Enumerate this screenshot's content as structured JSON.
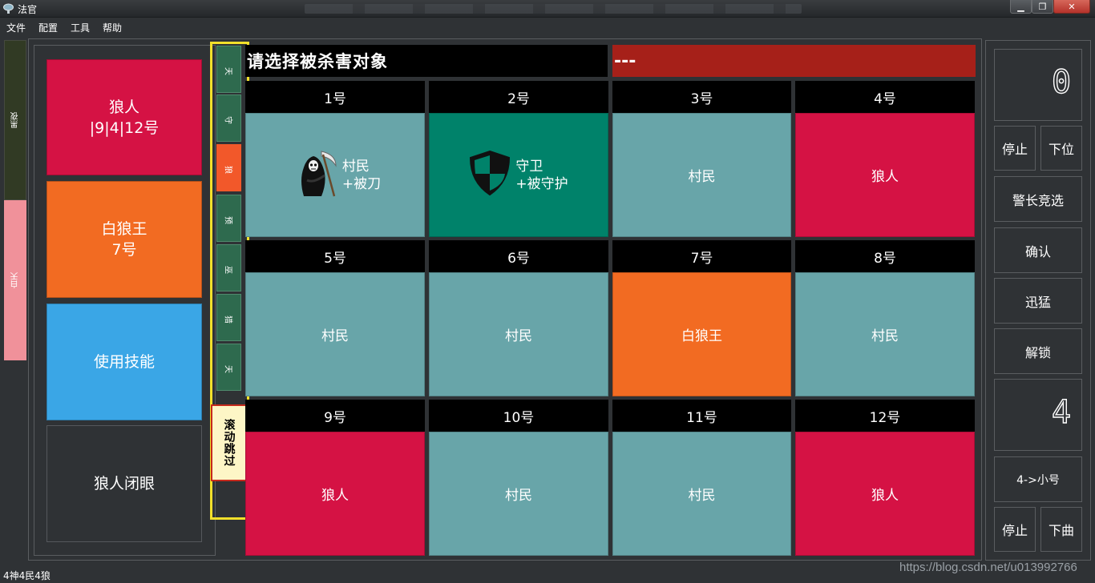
{
  "window": {
    "title": "法官"
  },
  "menu": [
    "文件",
    "配置",
    "工具",
    "帮助"
  ],
  "phase_tabs": {
    "night": "黑夜",
    "day": "白天"
  },
  "left_buttons": {
    "wolf": {
      "name": "狼人",
      "players": "|9|4|12号"
    },
    "white_wolf": {
      "name": "白狼王",
      "players": "7号"
    },
    "use_skill": "使用技能",
    "close_eyes": "狼人闭眼"
  },
  "role_tabs": [
    {
      "label": "天",
      "active": false
    },
    {
      "label": "守",
      "active": false
    },
    {
      "label": "狼",
      "active": true
    },
    {
      "label": "预",
      "active": false
    },
    {
      "label": "巫",
      "active": false
    },
    {
      "label": "猎",
      "active": false
    },
    {
      "label": "天",
      "active": false
    }
  ],
  "scroll_skip": "滚动跳过",
  "header": {
    "prompt": "请选择被杀害对象",
    "status": "---"
  },
  "players": [
    {
      "num": "1号",
      "role": "村民",
      "note": "+被刀",
      "icon": "reaper-icon",
      "color": "villager"
    },
    {
      "num": "2号",
      "role": "守卫",
      "note": "+被守护",
      "icon": "shield-icon",
      "color": "guard"
    },
    {
      "num": "3号",
      "role": "村民",
      "note": "",
      "icon": "",
      "color": "villager"
    },
    {
      "num": "4号",
      "role": "狼人",
      "note": "",
      "icon": "",
      "color": "wolf"
    },
    {
      "num": "5号",
      "role": "村民",
      "note": "",
      "icon": "",
      "color": "villager"
    },
    {
      "num": "6号",
      "role": "村民",
      "note": "",
      "icon": "",
      "color": "villager"
    },
    {
      "num": "7号",
      "role": "白狼王",
      "note": "",
      "icon": "",
      "color": "white"
    },
    {
      "num": "8号",
      "role": "村民",
      "note": "",
      "icon": "",
      "color": "villager"
    },
    {
      "num": "9号",
      "role": "狼人",
      "note": "",
      "icon": "",
      "color": "wolf"
    },
    {
      "num": "10号",
      "role": "村民",
      "note": "",
      "icon": "",
      "color": "villager"
    },
    {
      "num": "11号",
      "role": "村民",
      "note": "",
      "icon": "",
      "color": "villager"
    },
    {
      "num": "12号",
      "role": "狼人",
      "note": "",
      "icon": "",
      "color": "wolf"
    }
  ],
  "right_panel": {
    "counter_top": "0",
    "stop1": "停止",
    "down1": "下位",
    "sheriff": "警长竞选",
    "confirm": "确认",
    "fast": "迅猛",
    "unlock": "解锁",
    "counter_bottom": "4",
    "to_small": "4->小号",
    "stop2": "停止",
    "next_song": "下曲"
  },
  "status_bar": "4神4民4狼",
  "watermark": "https://blog.csdn.net/u013992766",
  "colors": {
    "wolf": "#d51244",
    "white_wolf": "#f26b22",
    "skill": "#3aa6e6",
    "villager": "#68a5a9",
    "guard": "#00826a",
    "status_red": "#a62019",
    "role_tab": "#2e6a4e",
    "role_tab_active": "#f2582a",
    "highlight": "#f2e02b"
  }
}
